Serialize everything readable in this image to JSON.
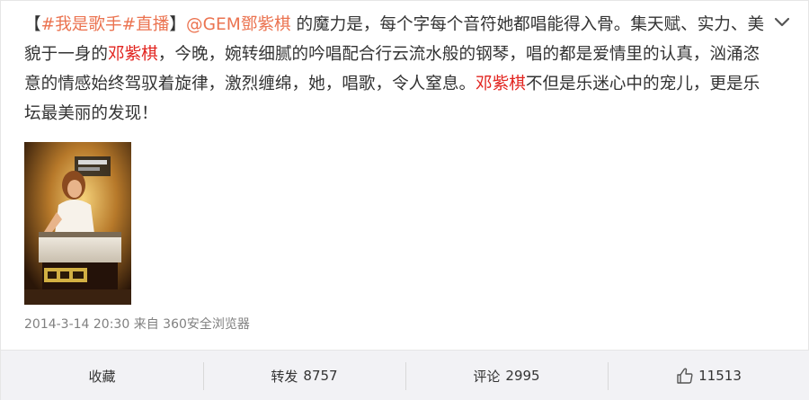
{
  "post": {
    "text": {
      "bracket_open": "【",
      "hashtag1": "#我是歌手#",
      "hashtag2": "直播",
      "bracket_close": "】",
      "mention": "@GEM鄧紫棋",
      "part1": " 的魔力是，每个字每个音符她都唱能得入骨。集天赋、实力、美貌于一身的",
      "name1": "邓紫棋",
      "part2": "，今晚，婉转细腻的吟唱配合行云流水般的钢琴，唱的都是爱情里的认真，汹涌恣意的情感始终驾驭着旋律，激烈缠绵，她，唱歌，令人窒息。",
      "name2": "邓紫棋",
      "part3": "不但是乐迷心中的宠儿，更是乐坛最美丽的发现！"
    },
    "image_alt": "邓紫棋钢琴演唱剧照",
    "meta": {
      "time": "2014-3-14 20:30",
      "from_label": "来自",
      "source": "360安全浏览器"
    },
    "actions": {
      "favorite_label": "收藏",
      "repost_label": "转发",
      "repost_count": "8757",
      "comment_label": "评论",
      "comment_count": "2995",
      "like_count": "11513"
    }
  },
  "icons": {
    "menu": "chevron-down-icon",
    "like": "thumbs-up-icon"
  },
  "colors": {
    "link": "#eb7350",
    "highlight_name": "#e2241f",
    "meta_text": "#808080",
    "action_bar_bg": "#f2f2f5"
  }
}
